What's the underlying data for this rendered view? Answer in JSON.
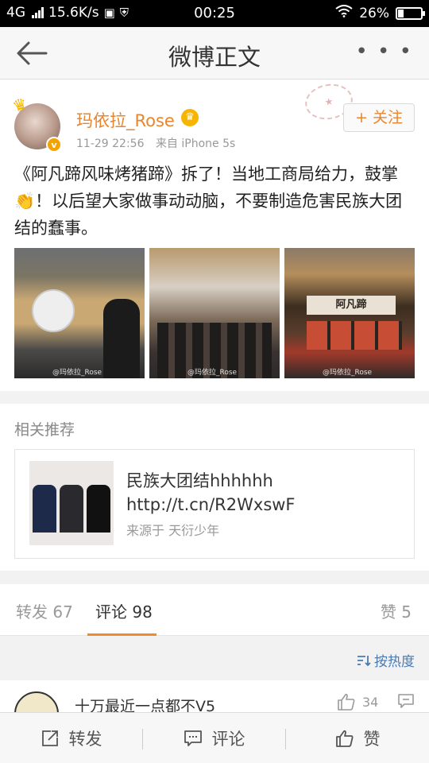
{
  "status_bar": {
    "network": "4G",
    "speed": "15.6K/s",
    "time": "00:25",
    "battery": "26%",
    "battery_level": 0.26
  },
  "nav": {
    "title": "微博正文",
    "back_icon": "back-arrow-icon",
    "more_icon": "more-icon"
  },
  "post": {
    "username": "玛依拉_Rose",
    "time": "11-29 22:56",
    "source": "来自 iPhone 5s",
    "follow_label": "+ 关注",
    "text": "《阿凡蹄风味烤猪蹄》拆了！当地工商局给力，鼓掌👏！以后望大家做事动动脑，不要制造危害民族大团结的蠢事。",
    "photo_watermark": "@玛依拉_Rose",
    "shop_sign": "阿凡蹄"
  },
  "related": {
    "title": "相关推荐",
    "card_title": "民族大团结hhhhhh http://t.cn/R2WxswF",
    "card_source": "来源于 天衍少年"
  },
  "tabs": {
    "repost": "转发 67",
    "comment": "评论 98",
    "like": "赞 5"
  },
  "sort": {
    "label": "按热度"
  },
  "comment": {
    "text": "十万最近一点都不V5",
    "likes": "34"
  },
  "bottom_bar": {
    "repost": "转发",
    "comment": "评论",
    "like": "赞"
  },
  "colors": {
    "accent": "#f08b2d",
    "username": "#e8852f",
    "link": "#4a7ab0"
  }
}
